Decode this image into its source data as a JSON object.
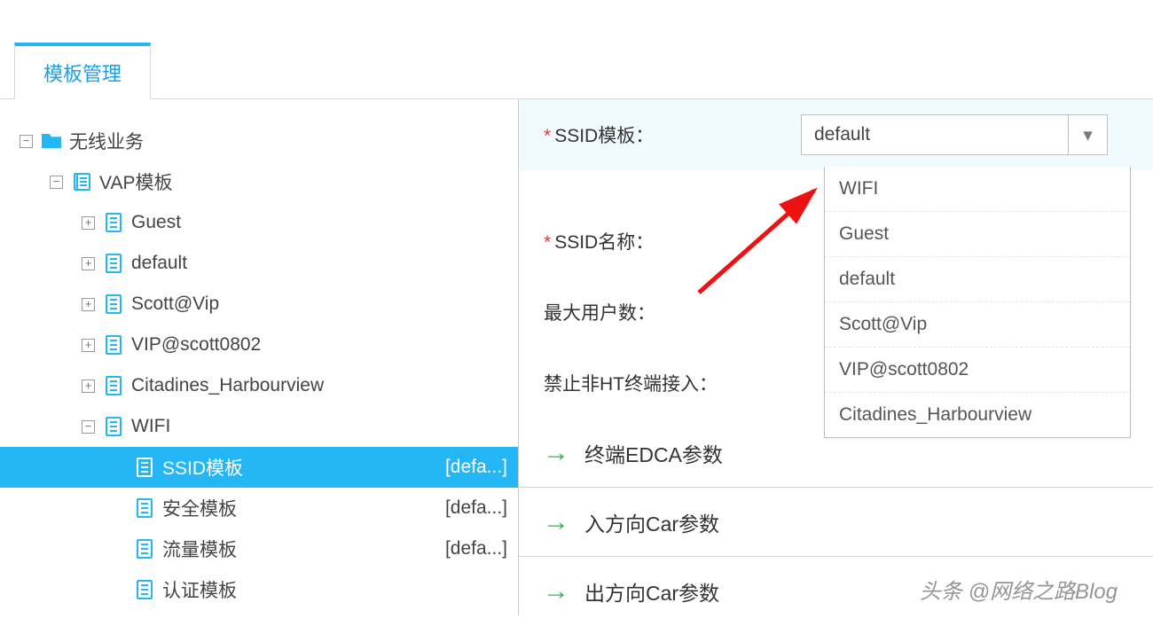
{
  "tabs": {
    "active": "模板管理"
  },
  "tree": {
    "root": {
      "label": "无线业务"
    },
    "vap": {
      "label": "VAP模板"
    },
    "leaves": [
      "Guest",
      "default",
      "Scott@Vip",
      "VIP@scott0802",
      "Citadines_Harbourview"
    ],
    "wifi": {
      "label": "WIFI"
    },
    "wifi_children": [
      {
        "label": "SSID模板",
        "suffix": "[defa...]",
        "selected": true
      },
      {
        "label": "安全模板",
        "suffix": "[defa...]",
        "selected": false
      },
      {
        "label": "流量模板",
        "suffix": "[defa...]",
        "selected": false
      },
      {
        "label": "认证模板",
        "suffix": "",
        "selected": false
      }
    ]
  },
  "form": {
    "ssid_template_label": "SSID模板：",
    "ssid_template_value": "default",
    "ssid_name_label": "SSID名称：",
    "max_users_label": "最大用户数：",
    "forbid_ht_label": "禁止非HT终端接入：",
    "edca_label": "终端EDCA参数",
    "car_in_label": "入方向Car参数",
    "car_out_label": "出方向Car参数"
  },
  "dropdown": {
    "options": [
      "WIFI",
      "Guest",
      "default",
      "Scott@Vip",
      "VIP@scott0802",
      "Citadines_Harbourview"
    ]
  },
  "watermark": "头条 @网络之路Blog"
}
